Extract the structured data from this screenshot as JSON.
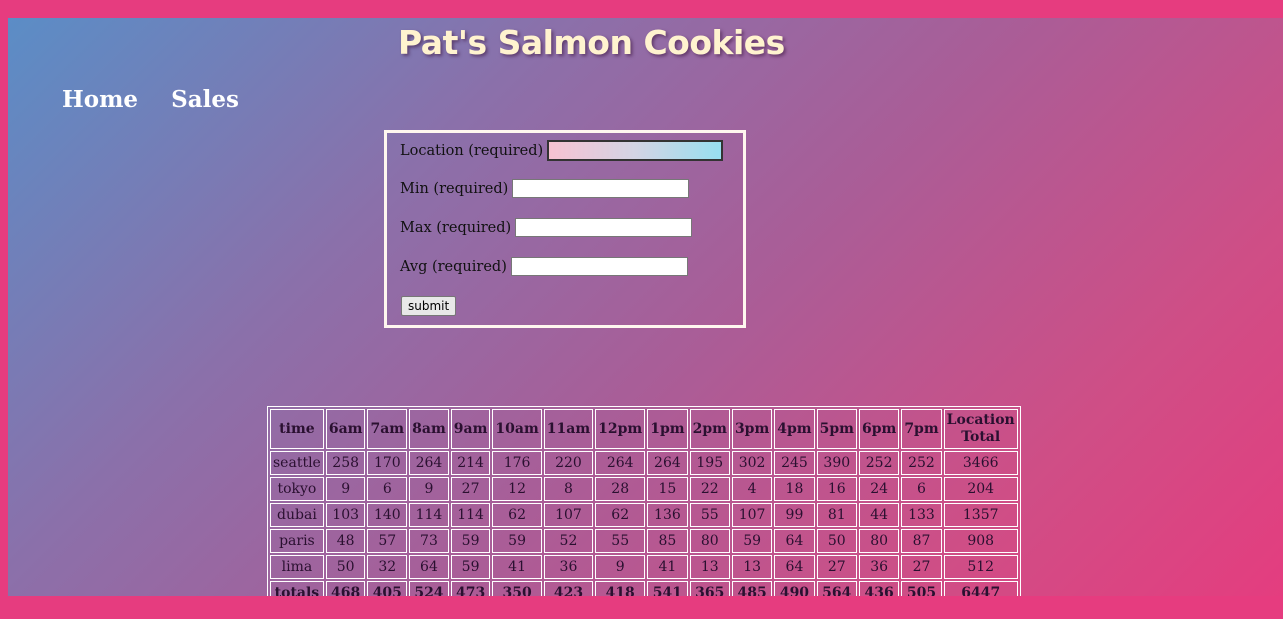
{
  "header": {
    "title": "Pat's Salmon Cookies"
  },
  "nav": {
    "items": [
      {
        "label": "Home"
      },
      {
        "label": "Sales"
      }
    ]
  },
  "form": {
    "location_label": "Location (required)",
    "min_label": "Min (required)",
    "max_label": "Max (required)",
    "avg_label": "Avg (required)",
    "submit_label": "submit"
  },
  "table": {
    "headers": [
      "time",
      "6am",
      "7am",
      "8am",
      "9am",
      "10am",
      "11am",
      "12pm",
      "1pm",
      "2pm",
      "3pm",
      "4pm",
      "5pm",
      "6pm",
      "7pm",
      "Location Total"
    ],
    "rows": [
      {
        "location": "seattle",
        "values": [
          "258",
          "170",
          "264",
          "214",
          "176",
          "220",
          "264",
          "264",
          "195",
          "302",
          "245",
          "390",
          "252",
          "252"
        ],
        "total": "3466"
      },
      {
        "location": "tokyo",
        "values": [
          "9",
          "6",
          "9",
          "27",
          "12",
          "8",
          "28",
          "15",
          "22",
          "4",
          "18",
          "16",
          "24",
          "6"
        ],
        "total": "204"
      },
      {
        "location": "dubai",
        "values": [
          "103",
          "140",
          "114",
          "114",
          "62",
          "107",
          "62",
          "136",
          "55",
          "107",
          "99",
          "81",
          "44",
          "133"
        ],
        "total": "1357"
      },
      {
        "location": "paris",
        "values": [
          "48",
          "57",
          "73",
          "59",
          "59",
          "52",
          "55",
          "85",
          "80",
          "59",
          "64",
          "50",
          "80",
          "87"
        ],
        "total": "908"
      },
      {
        "location": "lima",
        "values": [
          "50",
          "32",
          "64",
          "59",
          "41",
          "36",
          "9",
          "41",
          "13",
          "13",
          "64",
          "27",
          "36",
          "27"
        ],
        "total": "512"
      }
    ],
    "totals": {
      "label": "totals",
      "values": [
        "468",
        "405",
        "524",
        "473",
        "350",
        "423",
        "418",
        "541",
        "365",
        "485",
        "490",
        "564",
        "436",
        "505"
      ],
      "grand_total": "6447"
    }
  },
  "colors": {
    "page_border": "#e63c7f",
    "gradient_start": "#5b8dc6",
    "gradient_end": "#e43d7f",
    "title_color": "#fff3cf"
  }
}
